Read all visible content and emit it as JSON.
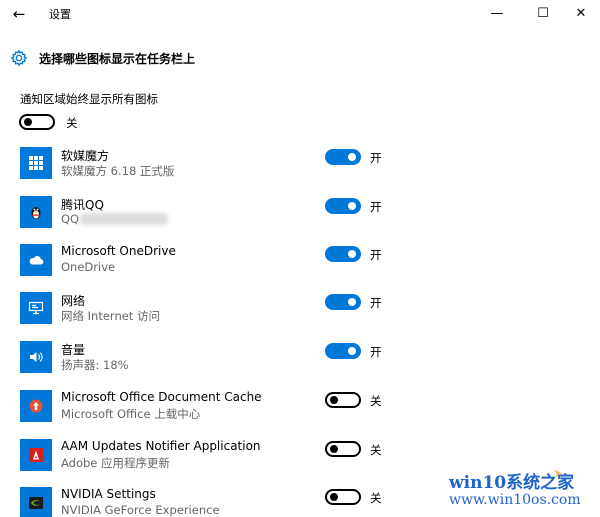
{
  "window": {
    "back_glyph": "←",
    "title": "设置",
    "minimize_glyph": "—",
    "maximize_glyph": "☐",
    "close_glyph": "✕"
  },
  "header": {
    "icon": "gear-icon",
    "title": "选择哪些图标显示在任务栏上"
  },
  "always_show": {
    "label": "通知区域始终显示所有图标",
    "state_label": "关",
    "on": false
  },
  "apps": [
    {
      "name": "软媒魔方",
      "subtitle": "软媒魔方 6.18 正式版",
      "icon": "grid-icon",
      "on": true,
      "state_label": "开"
    },
    {
      "name": "腾讯QQ",
      "subtitle": "QQ",
      "icon": "penguin-icon",
      "on": true,
      "state_label": "开"
    },
    {
      "name": "Microsoft OneDrive",
      "subtitle": "OneDrive",
      "icon": "cloud-icon",
      "on": true,
      "state_label": "开"
    },
    {
      "name": "网络",
      "subtitle": "网络 Internet 访问",
      "icon": "network-icon",
      "on": true,
      "state_label": "开"
    },
    {
      "name": "音量",
      "subtitle": "扬声器: 18%",
      "icon": "speaker-icon",
      "on": true,
      "state_label": "开"
    },
    {
      "name": "Microsoft Office Document Cache",
      "subtitle": "Microsoft Office 上载中心",
      "icon": "upload-icon",
      "on": false,
      "state_label": "关"
    },
    {
      "name": "AAM Updates Notifier Application",
      "subtitle": "Adobe 应用程序更新",
      "icon": "adobe-icon",
      "on": false,
      "state_label": "关"
    },
    {
      "name": "NVIDIA Settings",
      "subtitle": "NVIDIA GeForce Experience",
      "icon": "nvidia-icon",
      "on": false,
      "state_label": "关"
    }
  ],
  "colors": {
    "accent": "#0078d7",
    "subtext": "#666666",
    "adobe_red": "#d81e1e",
    "upload_red": "#e2533a",
    "nvidia_green": "#76b900"
  },
  "watermark": {
    "line1": "win10系统之家",
    "line2": "www.win10os.com"
  }
}
